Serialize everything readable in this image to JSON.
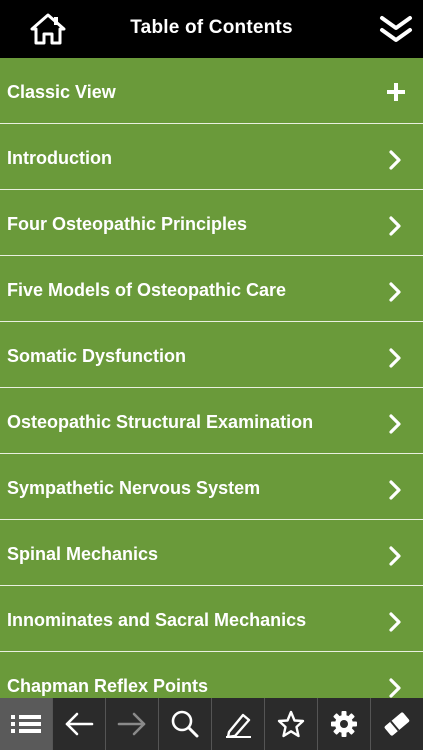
{
  "header": {
    "title": "Table of Contents",
    "home_icon": "home-icon",
    "collapse_icon": "double-chevron-down-icon"
  },
  "colors": {
    "header_bg": "#000000",
    "row_bg": "#6a9a3a",
    "row_divider": "#e9f0df",
    "toolbar_bg": "#2b2b2b",
    "toolbar_active": "#5a5a5a"
  },
  "toc": {
    "items": [
      {
        "label": "Classic View",
        "icon": "plus-icon"
      },
      {
        "label": "Introduction",
        "icon": "chevron-right-icon"
      },
      {
        "label": "Four Osteopathic Principles",
        "icon": "chevron-right-icon"
      },
      {
        "label": "Five Models of Osteopathic Care",
        "icon": "chevron-right-icon"
      },
      {
        "label": "Somatic Dysfunction",
        "icon": "chevron-right-icon"
      },
      {
        "label": "Osteopathic Structural Examination",
        "icon": "chevron-right-icon"
      },
      {
        "label": "Sympathetic Nervous System",
        "icon": "chevron-right-icon"
      },
      {
        "label": "Spinal Mechanics",
        "icon": "chevron-right-icon"
      },
      {
        "label": "Innominates and Sacral Mechanics",
        "icon": "chevron-right-icon"
      },
      {
        "label": "Chapman Reflex Points",
        "icon": "chevron-right-icon"
      }
    ]
  },
  "toolbar": {
    "items": [
      {
        "icon": "list-icon",
        "active": true
      },
      {
        "icon": "arrow-left-icon",
        "active": false
      },
      {
        "icon": "arrow-right-icon",
        "active": false
      },
      {
        "icon": "search-icon",
        "active": false
      },
      {
        "icon": "pencil-icon",
        "active": false
      },
      {
        "icon": "star-icon",
        "active": false
      },
      {
        "icon": "gear-icon",
        "active": false
      },
      {
        "icon": "eraser-icon",
        "active": false
      }
    ]
  }
}
